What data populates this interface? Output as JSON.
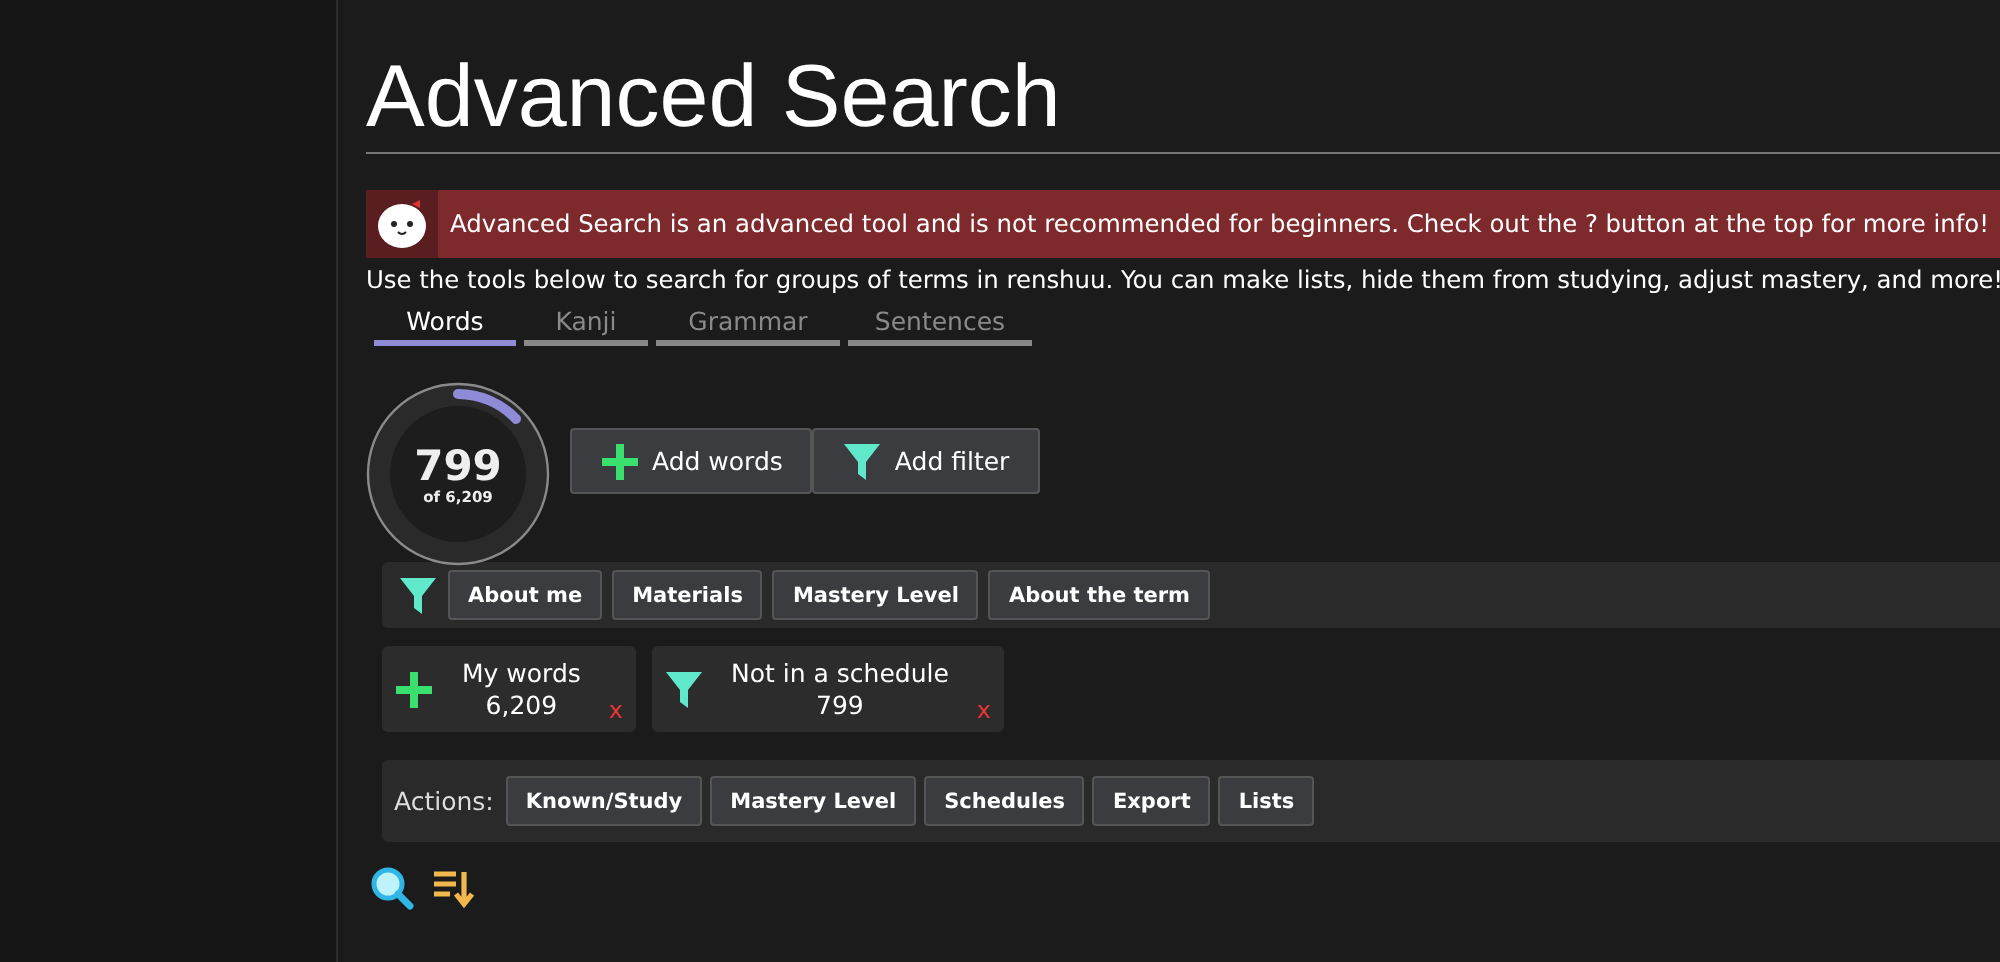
{
  "title": "Advanced Search",
  "banner": {
    "text": "Advanced Search is an advanced tool and is not recommended for beginners. Check out the ? button at the top for more info!"
  },
  "intro": "Use the tools below to search for groups of terms in renshuu. You can make lists, hide them from studying, adjust mastery, and more!",
  "tabs": [
    {
      "label": "Words",
      "selected": true
    },
    {
      "label": "Kanji",
      "selected": false
    },
    {
      "label": "Grammar",
      "selected": false
    },
    {
      "label": "Sentences",
      "selected": false
    }
  ],
  "counter": {
    "count": "799",
    "total": "of 6,209",
    "level": 0.129
  },
  "top_buttons": [
    {
      "kind": "add",
      "label": "Add words"
    },
    {
      "kind": "filter",
      "label": "Add filter"
    }
  ],
  "filter_categories": [
    "About me",
    "Materials",
    "Mastery Level",
    "About the term"
  ],
  "active_filters": [
    {
      "kind": "add",
      "label": "My words",
      "count": "6,209",
      "remove": "x"
    },
    {
      "kind": "filter",
      "label": "Not in a schedule",
      "count": "799",
      "remove": "x"
    }
  ],
  "actions": {
    "label": "Actions:",
    "buttons": [
      "Known/Study",
      "Mastery Level",
      "Schedules",
      "Export",
      "Lists"
    ]
  }
}
